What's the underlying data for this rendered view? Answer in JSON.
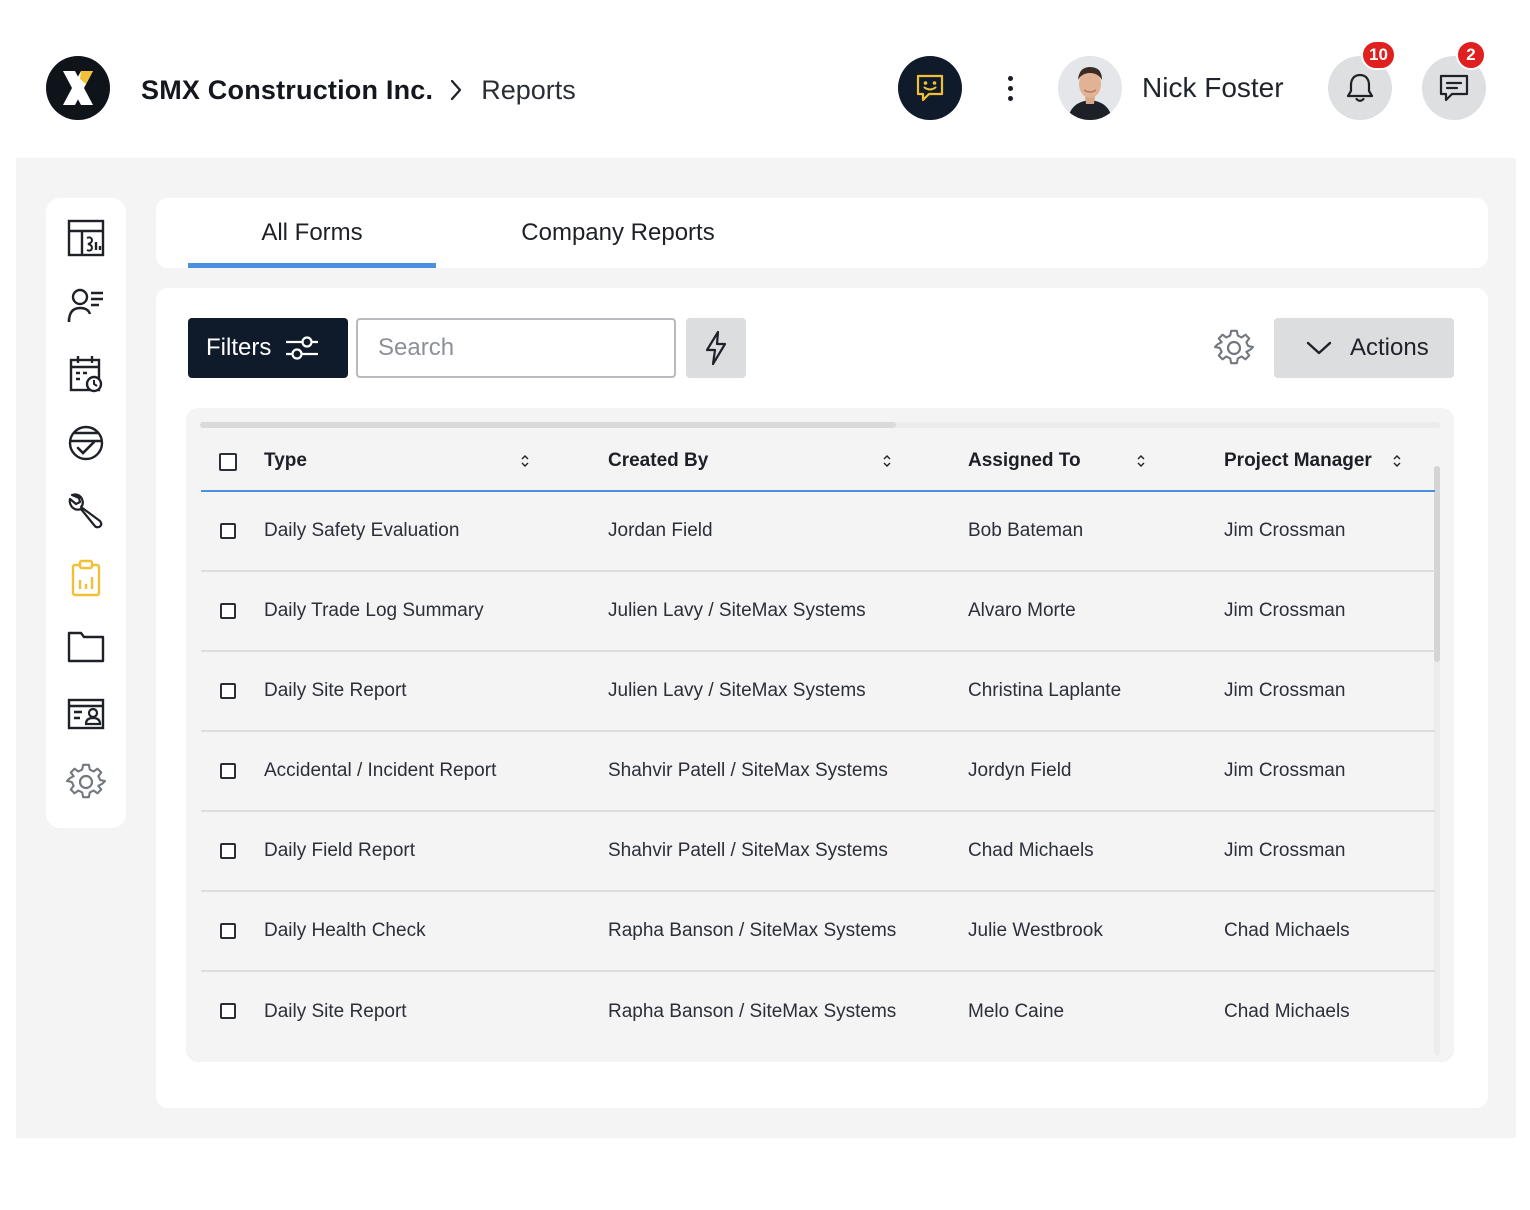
{
  "header": {
    "company": "SMX Construction Inc.",
    "page": "Reports",
    "user_name": "Nick Foster",
    "notifications_count": "10",
    "messages_count": "2"
  },
  "sidebar": {
    "items": [
      {
        "icon": "dashboard-icon"
      },
      {
        "icon": "contacts-icon"
      },
      {
        "icon": "schedule-icon"
      },
      {
        "icon": "inspection-icon"
      },
      {
        "icon": "tools-icon"
      },
      {
        "icon": "reports-icon",
        "active": true
      },
      {
        "icon": "folder-icon"
      },
      {
        "icon": "id-card-icon"
      },
      {
        "icon": "settings-icon"
      }
    ]
  },
  "tabs": [
    {
      "label": "All Forms",
      "active": true
    },
    {
      "label": "Company Reports",
      "active": false
    }
  ],
  "toolbar": {
    "filters_label": "Filters",
    "search_placeholder": "Search",
    "actions_label": "Actions"
  },
  "table": {
    "columns": [
      "Type",
      "Created By",
      "Assigned To",
      "Project Manager"
    ],
    "rows": [
      [
        "Daily Safety Evaluation",
        "Jordan Field",
        "Bob Bateman",
        "Jim Crossman"
      ],
      [
        "Daily Trade Log Summary",
        "Julien Lavy / SiteMax Systems",
        "Alvaro Morte",
        "Jim Crossman"
      ],
      [
        "Daily Site Report",
        "Julien Lavy / SiteMax Systems",
        "Christina Laplante",
        "Jim Crossman"
      ],
      [
        "Accidental / Incident Report",
        "Shahvir Patell / SiteMax Systems",
        "Jordyn Field",
        "Jim Crossman"
      ],
      [
        "Daily Field Report",
        "Shahvir Patell / SiteMax Systems",
        "Chad Michaels",
        "Jim Crossman"
      ],
      [
        "Daily Health Check",
        "Rapha Banson / SiteMax Systems",
        "Julie Westbrook",
        "Chad Michaels"
      ],
      [
        "Daily Site Report",
        "Rapha Banson / SiteMax Systems",
        "Melo Caine",
        "Chad Michaels"
      ]
    ]
  },
  "colors": {
    "brand_dark": "#0f1a2a",
    "accent_blue": "#4a8fe0",
    "accent_yellow": "#f2c037",
    "badge_red": "#e0201f"
  }
}
